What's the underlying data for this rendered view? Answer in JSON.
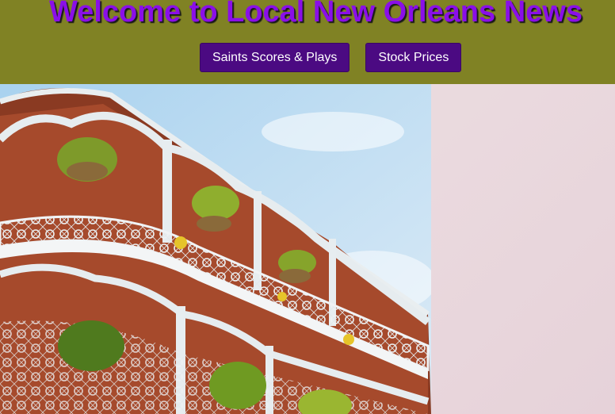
{
  "header": {
    "title": "Welcome to Local New Orleans News",
    "nav": [
      {
        "label": "Saints Scores & Plays"
      },
      {
        "label": "Stock Prices"
      }
    ]
  },
  "hero": {
    "image": "french-quarter-balcony-photo"
  },
  "colors": {
    "header_bg": "#808224",
    "title": "#8a0fe8",
    "nav_button_bg": "#4b0a82",
    "page_bg": "#e9dbdf"
  }
}
